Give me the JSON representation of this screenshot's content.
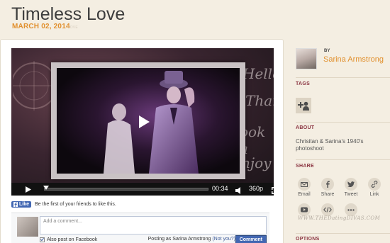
{
  "post": {
    "title": "Timeless Love",
    "date": "MARCH 02, 2014",
    "date_suffix": "LOVE"
  },
  "video": {
    "overlay_lines": [
      "Hello",
      "Thank",
      "ook a",
      "njoy"
    ],
    "time": "00:34",
    "quality": "360p",
    "progress": 0.0
  },
  "facebook": {
    "like_label": "Like",
    "like_text": "Be the first of your friends to like this.",
    "comment_placeholder": "Add a comment...",
    "also_post_label": "Also post on Facebook",
    "posting_as_prefix": "Posting as Sarina Armstrong",
    "not_you": "(Not you?)",
    "comment_button": "Comment"
  },
  "sidebar": {
    "by_label": "BY",
    "author_name": "Sarina Armstrong",
    "tags_heading": "TAGS",
    "about_heading": "ABOUT",
    "about_text": "Chrisitan & Sarina's 1940's photoshoot",
    "share_heading": "SHARE",
    "options_heading": "OPTIONS",
    "share_items": [
      {
        "label": "Email",
        "icon": "email-icon"
      },
      {
        "label": "Share",
        "icon": "facebook-icon"
      },
      {
        "label": "Tweet",
        "icon": "twitter-icon"
      },
      {
        "label": "Link",
        "icon": "link-icon"
      },
      {
        "label": "",
        "icon": "youtube-icon"
      },
      {
        "label": "",
        "icon": "embed-icon"
      },
      {
        "label": "",
        "icon": "more-icon"
      }
    ]
  },
  "watermark": "WWW.THEDatingDIVAS.COM",
  "colors": {
    "accent": "#e1902e",
    "heading": "#8a3340",
    "background": "#f4eee2",
    "facebook": "#4267b2"
  }
}
